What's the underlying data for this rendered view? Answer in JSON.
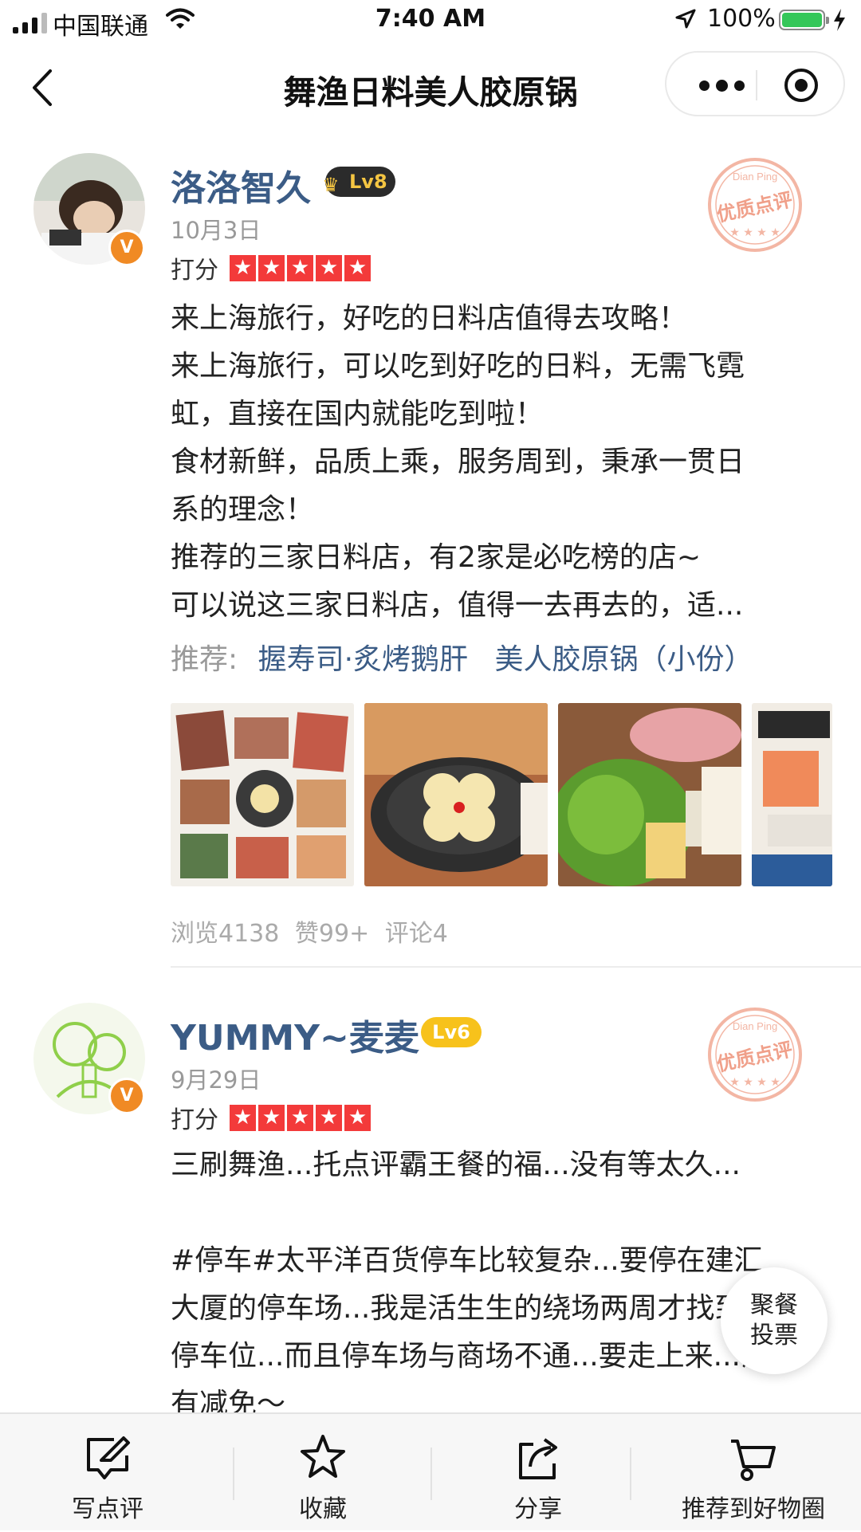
{
  "status_bar": {
    "carrier": "中国联通",
    "time": "7:40 AM",
    "battery": "100%"
  },
  "nav": {
    "title": "舞渔日料美人胶原锅"
  },
  "reviews": [
    {
      "username": "洛洛智久",
      "level": "Lv8",
      "date": "10月3日",
      "rating_label": "打分",
      "stars": 5,
      "stamp_text": "优质点评",
      "stamp_brand": "Dian Ping",
      "lines": [
        "来上海旅行，好吃的日料店值得去攻略！",
        "来上海旅行，可以吃到好吃的日料，无需飞霓",
        "虹，直接在国内就能吃到啦！",
        "食材新鲜，品质上乘，服务周到，秉承一贯日",
        "系的理念！",
        "推荐的三家日料店，有2家是必吃榜的店~",
        "可以说这三家日料店，值得一去再去的，适..."
      ],
      "recommend_label": "推荐:",
      "recommend_dishes": [
        "握寿司·炙烤鹅肝",
        "美人胶原锅（小份）"
      ],
      "stats": {
        "views": "浏览4138",
        "likes": "赞99+",
        "comments": "评论4"
      }
    },
    {
      "username": "YUMMY~麦麦",
      "level": "Lv6",
      "date": "9月29日",
      "rating_label": "打分",
      "stars": 5,
      "stamp_text": "优质点评",
      "stamp_brand": "Dian Ping",
      "lines": [
        "三刷舞渔...托点评霸王餐的福...没有等太久...",
        "",
        "#停车#太平洋百货停车比较复杂...要停在建汇",
        "大厦的停车场...我是活生生的绕场两周才找到",
        "停车位...而且停车场与商场不通...要走上来...没",
        "有减免～"
      ]
    }
  ],
  "float_button": {
    "line1": "聚餐",
    "line2": "投票"
  },
  "tabbar": [
    {
      "label": "写点评",
      "icon": "write-review-icon"
    },
    {
      "label": "收藏",
      "icon": "star-icon"
    },
    {
      "label": "分享",
      "icon": "share-icon"
    },
    {
      "label": "推荐到好物圈",
      "icon": "cart-icon"
    }
  ],
  "colors": {
    "username": "#3b5c86",
    "star": "#f33a3a",
    "vip_badge": "#f08a24",
    "stamp": "#f0a08a",
    "lv8_bg": "#2b2b2b",
    "lv6_bg": "#f7c21b"
  }
}
